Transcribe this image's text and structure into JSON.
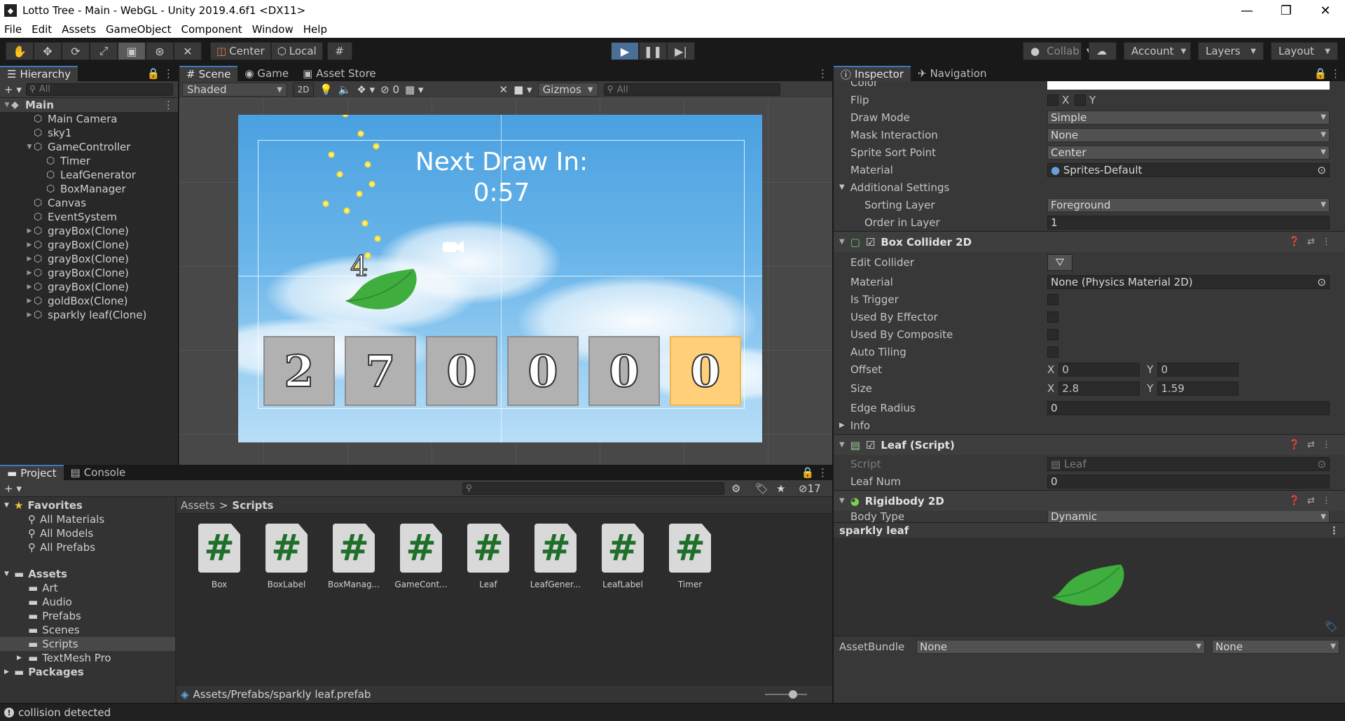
{
  "window": {
    "title": "Lotto Tree - Main - WebGL - Unity 2019.4.6f1 <DX11>"
  },
  "menu": [
    "File",
    "Edit",
    "Assets",
    "GameObject",
    "Component",
    "Window",
    "Help"
  ],
  "toolbar": {
    "center": "Center",
    "local": "Local",
    "collab": "Collab",
    "account": "Account",
    "layers": "Layers",
    "layout": "Layout"
  },
  "hierarchy": {
    "tab": "Hierarchy",
    "search_placeholder": "All",
    "root": "Main",
    "items": [
      {
        "label": "Main Camera",
        "depth": 1,
        "arrow": ""
      },
      {
        "label": "sky1",
        "depth": 1,
        "arrow": ""
      },
      {
        "label": "GameController",
        "depth": 1,
        "arrow": "▼"
      },
      {
        "label": "Timer",
        "depth": 2,
        "arrow": ""
      },
      {
        "label": "LeafGenerator",
        "depth": 2,
        "arrow": ""
      },
      {
        "label": "BoxManager",
        "depth": 2,
        "arrow": ""
      },
      {
        "label": "Canvas",
        "depth": 1,
        "arrow": ""
      },
      {
        "label": "EventSystem",
        "depth": 1,
        "arrow": ""
      },
      {
        "label": "grayBox(Clone)",
        "depth": 1,
        "arrow": "▶"
      },
      {
        "label": "grayBox(Clone)",
        "depth": 1,
        "arrow": "▶"
      },
      {
        "label": "grayBox(Clone)",
        "depth": 1,
        "arrow": "▶"
      },
      {
        "label": "grayBox(Clone)",
        "depth": 1,
        "arrow": "▶"
      },
      {
        "label": "grayBox(Clone)",
        "depth": 1,
        "arrow": "▶"
      },
      {
        "label": "goldBox(Clone)",
        "depth": 1,
        "arrow": "▶"
      },
      {
        "label": "sparkly leaf(Clone)",
        "depth": 1,
        "arrow": "▶"
      }
    ]
  },
  "scene": {
    "tabs": [
      "Scene",
      "Game",
      "Asset Store"
    ],
    "shading": "Shaded",
    "mode2d": "2D",
    "hidden_count": "0",
    "gizmos": "Gizmos",
    "search_placeholder": "All",
    "game": {
      "next_draw": "Next Draw In:",
      "timer": "0:57",
      "leaf_num": "4",
      "boxes": [
        "2",
        "7",
        "0",
        "0",
        "0",
        "0"
      ]
    }
  },
  "inspector": {
    "tabs": [
      "Inspector",
      "Navigation"
    ],
    "color_label": "Color",
    "flip": {
      "label": "Flip",
      "x": "X",
      "y": "Y"
    },
    "rows": [
      {
        "label": "Draw Mode",
        "value": "Simple"
      },
      {
        "label": "Mask Interaction",
        "value": "None"
      },
      {
        "label": "Sprite Sort Point",
        "value": "Center"
      }
    ],
    "material": {
      "label": "Material",
      "value": "Sprites-Default"
    },
    "additional_settings": "Additional Settings",
    "sorting_layer": {
      "label": "Sorting Layer",
      "value": "Foreground"
    },
    "order_in_layer": {
      "label": "Order in Layer",
      "value": "1"
    },
    "box_collider": {
      "title": "Box Collider 2D",
      "edit_collider": "Edit Collider",
      "material": {
        "label": "Material",
        "value": "None (Physics Material 2D)"
      },
      "toggles": [
        "Is Trigger",
        "Used By Effector",
        "Used By Composite",
        "Auto Tiling"
      ],
      "offset": {
        "label": "Offset",
        "x": "0",
        "y": "0"
      },
      "size": {
        "label": "Size",
        "x": "2.8",
        "y": "1.59"
      },
      "edge_radius": {
        "label": "Edge Radius",
        "value": "0"
      },
      "info": "Info"
    },
    "leaf_script": {
      "title": "Leaf (Script)",
      "script": {
        "label": "Script",
        "value": "Leaf"
      },
      "leaf_num": {
        "label": "Leaf Num",
        "value": "0"
      }
    },
    "rigidbody": {
      "title": "Rigidbody 2D",
      "body_type": {
        "label": "Body Type",
        "value": "Dynamic"
      }
    },
    "preview_title": "sparkly leaf",
    "assetbundle": {
      "label": "AssetBundle",
      "value": "None",
      "variant": "None"
    }
  },
  "project": {
    "tabs": [
      "Project",
      "Console"
    ],
    "hidden_count": "17",
    "favorites": "Favorites",
    "fav_items": [
      "All Materials",
      "All Models",
      "All Prefabs"
    ],
    "assets": "Assets",
    "asset_folders": [
      "Art",
      "Audio",
      "Prefabs",
      "Scenes",
      "Scripts",
      "TextMesh Pro"
    ],
    "packages": "Packages",
    "breadcrumb": [
      "Assets",
      "Scripts"
    ],
    "files": [
      "Box",
      "BoxLabel",
      "BoxManag...",
      "GameCont...",
      "Leaf",
      "LeafGener...",
      "LeafLabel",
      "Timer"
    ],
    "path": "Assets/Prefabs/sparkly leaf.prefab"
  },
  "status": {
    "message": "collision detected"
  },
  "colors": {
    "accent": "#3a79bb",
    "play_active": "#4a6e96",
    "leaf": "#3fae3f",
    "gold_box": "#ffcf7a"
  }
}
